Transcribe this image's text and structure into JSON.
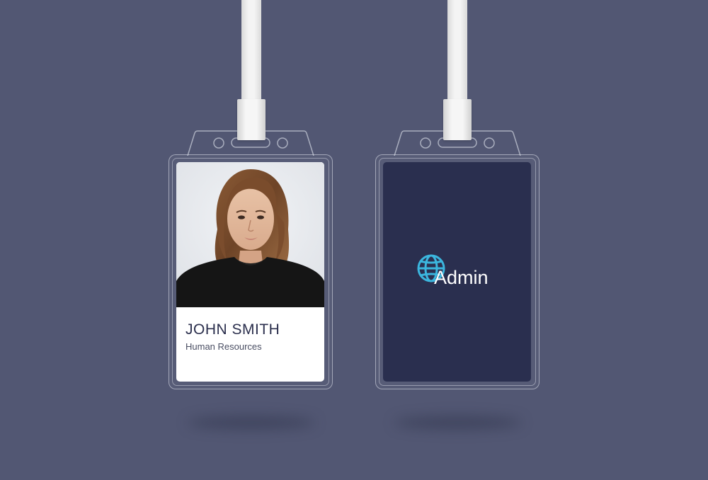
{
  "badges": {
    "front": {
      "name": "JOHN SMITH",
      "department": "Human Resources",
      "photo_alt": "Employee portrait"
    },
    "back": {
      "logo_text": "Admin",
      "logo_icon": "globe-icon",
      "logo_color": "#3bb6de"
    }
  },
  "colors": {
    "background": "#525773",
    "card_back": "#2a2f4f",
    "name_text": "#2b2f4d"
  }
}
